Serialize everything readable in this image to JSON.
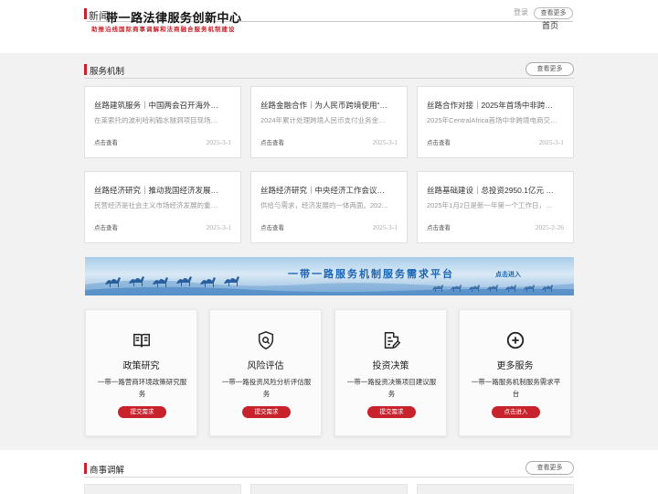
{
  "header": {
    "news": "新闻",
    "title": "带一路法律服务创新中心",
    "subtitle": "助推沿线国际商事调解和法商融合服务机制建设",
    "login": "登录",
    "more_pill": "查看更多",
    "home": "首页"
  },
  "service_mechanism": {
    "title": "服务机制",
    "more": "查看更多",
    "cards": [
      {
        "title": "丝路建筑服务｜中国两会召开海外…",
        "desc": "在莱索托的波利哈利输水隧洞项目现场…",
        "link": "点击查看",
        "date": "2025-3-1"
      },
      {
        "title": "丝路金融合作｜为人民币跨境使用“…",
        "desc": "2024年累计处理跨境人民币支付业务金…",
        "link": "点击查看",
        "date": "2025-3-1"
      },
      {
        "title": "丝路合作对接｜2025年首场中非跨…",
        "desc": "2025年CentralAfrica首场中非跨境电商交…",
        "link": "点击查看",
        "date": "2025-3-1"
      },
      {
        "title": "丝路经济研究｜推动我国经济发展…",
        "desc": "民营经济是社会主义市场经济发展的重…",
        "link": "点击查看",
        "date": "2025-3-1"
      },
      {
        "title": "丝路经济研究｜中央经济工作会议…",
        "desc": "供给与需求，经济发展的一体两面。202…",
        "link": "点击查看",
        "date": "2025-3-1"
      },
      {
        "title": "丝路基础建设｜总投资2950.1亿元 …",
        "desc": "2025年1月2日是新一年第一个工作日，…",
        "link": "点击查看",
        "date": "2025-2-26"
      }
    ]
  },
  "banner": {
    "text": "一带一路服务机制服务需求平台",
    "cta": "点击进入"
  },
  "services": [
    {
      "icon": "book-icon",
      "name": "政策研究",
      "desc": "一带一路营商环境政策研究服务",
      "button": "提交需求"
    },
    {
      "icon": "shield-search-icon",
      "name": "风险评估",
      "desc": "一带一路投资风险分析评估服务",
      "button": "提交需求"
    },
    {
      "icon": "document-edit-icon",
      "name": "投资决策",
      "desc": "一带一路投资决策项目建议服务",
      "button": "提交需求"
    },
    {
      "icon": "plus-circle-icon",
      "name": "更多服务",
      "desc": "一带一路服务机制服务需求平台",
      "button": "点击进入"
    }
  ],
  "commercial_mediation": {
    "title": "商事调解",
    "more": "查看更多"
  },
  "colors": {
    "accent": "#c8232c",
    "banner_text": "#1b64b5"
  }
}
